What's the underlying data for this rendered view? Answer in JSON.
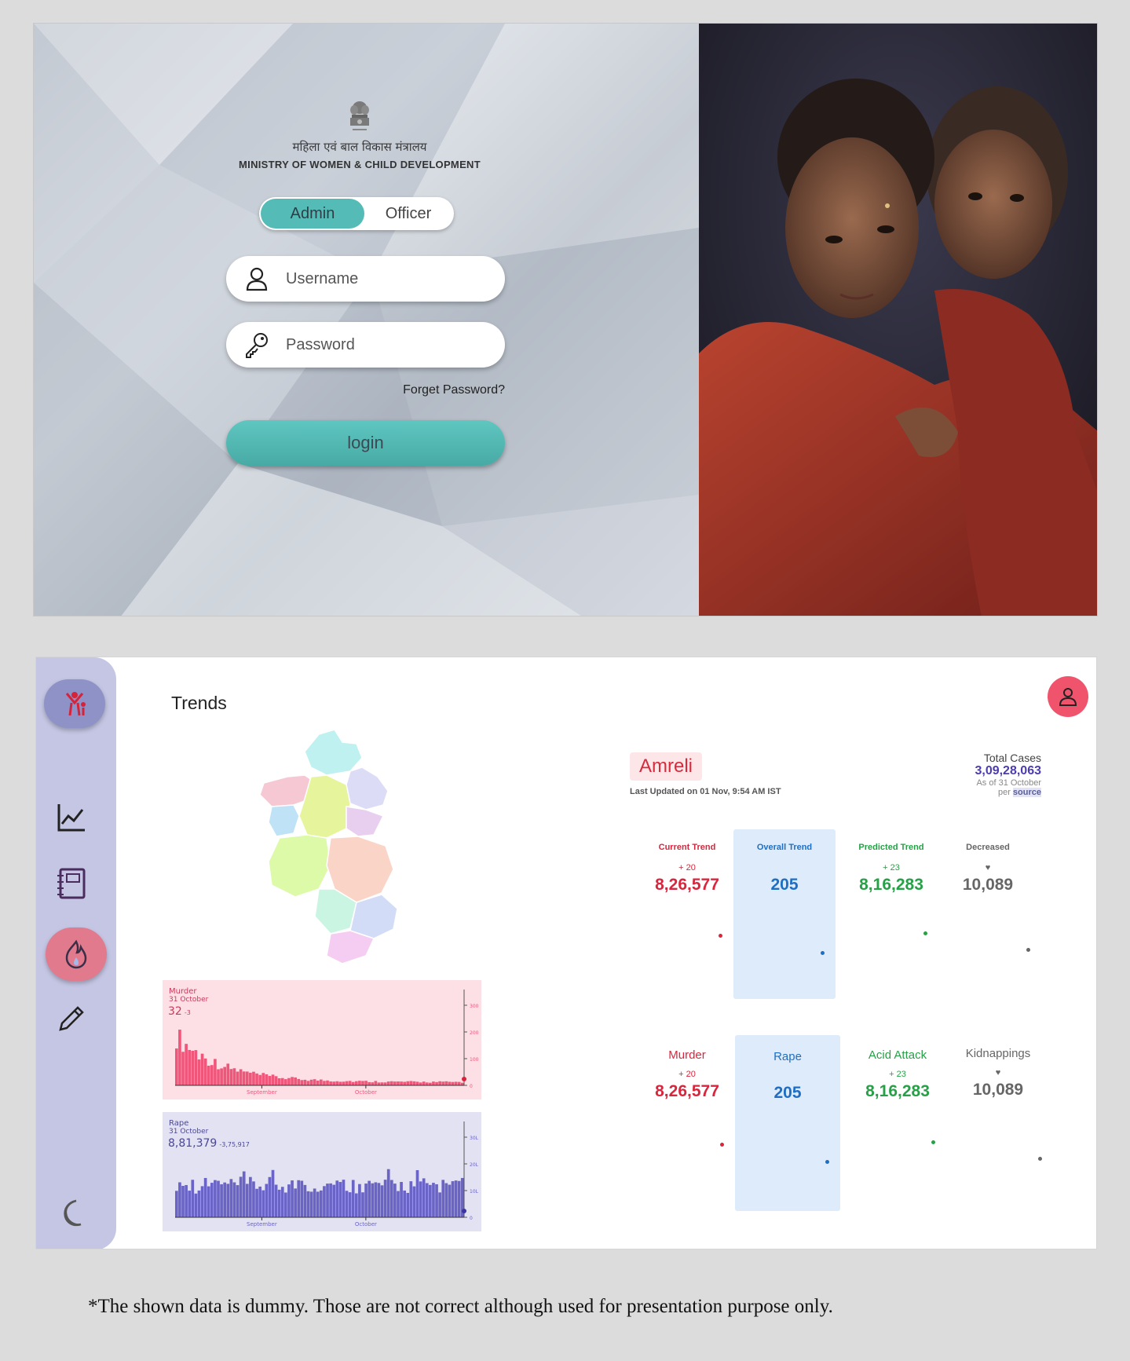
{
  "login": {
    "hindi_title": "महिला एवं बाल विकास मंत्रालय",
    "english_title": "MINISTRY OF WOMEN & CHILD DEVELOPMENT",
    "roles": {
      "admin": "Admin",
      "officer": "Officer",
      "selected": "Admin"
    },
    "username_placeholder": "Username",
    "password_placeholder": "Password",
    "forget_password": "Forget Password?",
    "login_button": "login",
    "colors": {
      "accent": "#55bbb6"
    },
    "icons": {
      "emblem": "national-emblem-icon",
      "user": "user-icon",
      "key": "key-icon"
    }
  },
  "dashboard": {
    "title": "Trends",
    "sidebar_icons": [
      "logo-icon",
      "line-chart-icon",
      "notebook-icon",
      "flame-icon",
      "pencil-icon",
      "moon-icon"
    ],
    "region": {
      "name": "Amreli",
      "last_updated": "Last Updated on 01 Nov, 9:54 AM IST"
    },
    "total_cases": {
      "label": "Total Cases",
      "value": "3,09,28,063",
      "as_of": "As of 31 October",
      "per": "per",
      "source": "source"
    },
    "trend_stats": [
      {
        "label": "Current Trend",
        "delta": "+ 20",
        "value": "8,26,577",
        "color": "red"
      },
      {
        "label": "Overall Trend",
        "delta": "",
        "value": "205",
        "color": "blue"
      },
      {
        "label": "Predicted Trend",
        "delta": "+ 23",
        "value": "8,16,283",
        "color": "green"
      },
      {
        "label": "Decreased",
        "delta": "♥",
        "value": "10,089",
        "color": "gray"
      }
    ],
    "crime_stats": [
      {
        "label": "Murder",
        "delta": "+ 20",
        "value": "8,26,577",
        "color": "red"
      },
      {
        "label": "Rape",
        "delta": "",
        "value": "205",
        "color": "blue"
      },
      {
        "label": "Acid Attack",
        "delta": "+ 23",
        "value": "8,16,283",
        "color": "green"
      },
      {
        "label": "Kidnappings",
        "delta": "♥",
        "value": "10,089",
        "color": "gray"
      }
    ],
    "murder_chart": {
      "title": "Murder",
      "date": "31 October",
      "value": "32",
      "delta": "-3",
      "x_labels": [
        "September",
        "October"
      ],
      "y_ticks": [
        "300",
        "200",
        "100",
        "0"
      ],
      "color": "#f0567a"
    },
    "rape_chart": {
      "title": "Rape",
      "date": "31 October",
      "value": "8,81,379",
      "delta": "-3,75,917",
      "x_labels": [
        "September",
        "October"
      ],
      "y_ticks": [
        "30L",
        "20L",
        "10L",
        "0"
      ],
      "color": "#6a64c6"
    }
  },
  "footnote": "*The shown data is dummy. Those are not correct although used for presentation purpose only."
}
